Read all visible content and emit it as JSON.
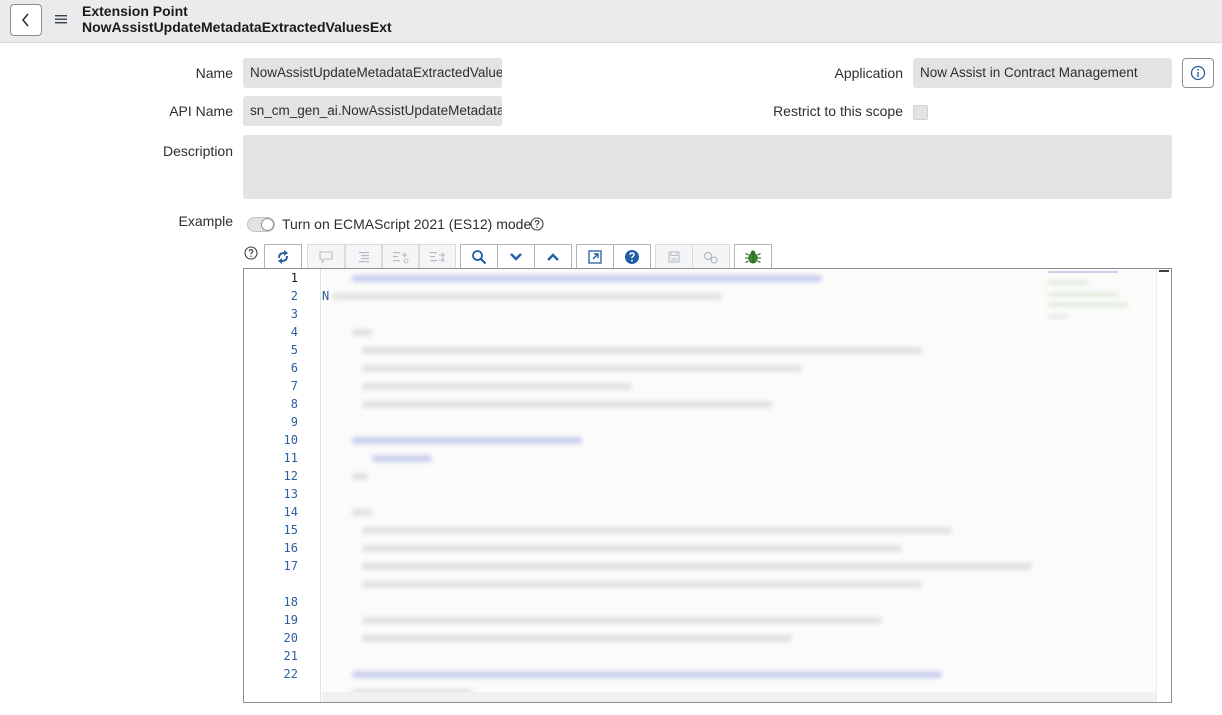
{
  "header": {
    "title_line1": "Extension Point",
    "title_line2": "NowAssistUpdateMetadataExtractedValuesExt"
  },
  "form": {
    "name_label": "Name",
    "name_value": "NowAssistUpdateMetadataExtractedValuesExt",
    "api_name_label": "API Name",
    "api_name_value": "sn_cm_gen_ai.NowAssistUpdateMetadataExtractedValuesExt",
    "application_label": "Application",
    "application_value": "Now Assist in Contract Management",
    "restrict_label": "Restrict to this scope",
    "restrict_checked": false,
    "description_label": "Description",
    "description_value": "",
    "example_label": "Example",
    "es12_toggle_label": "Turn on ECMAScript 2021 (ES12) mode",
    "es12_enabled": false
  },
  "editor": {
    "line_numbers": [
      "1",
      "2",
      "3",
      "4",
      "5",
      "6",
      "7",
      "8",
      "9",
      "10",
      "11",
      "12",
      "13",
      "14",
      "15",
      "16",
      "17",
      "18",
      "19",
      "20",
      "21",
      "22"
    ],
    "visible_char_line2": "N"
  },
  "icons": {
    "back": "chevron-left-icon",
    "menu": "hamburger-icon",
    "info": "info-icon",
    "help": "question-circle-icon",
    "accent": "#1f5fa8"
  }
}
